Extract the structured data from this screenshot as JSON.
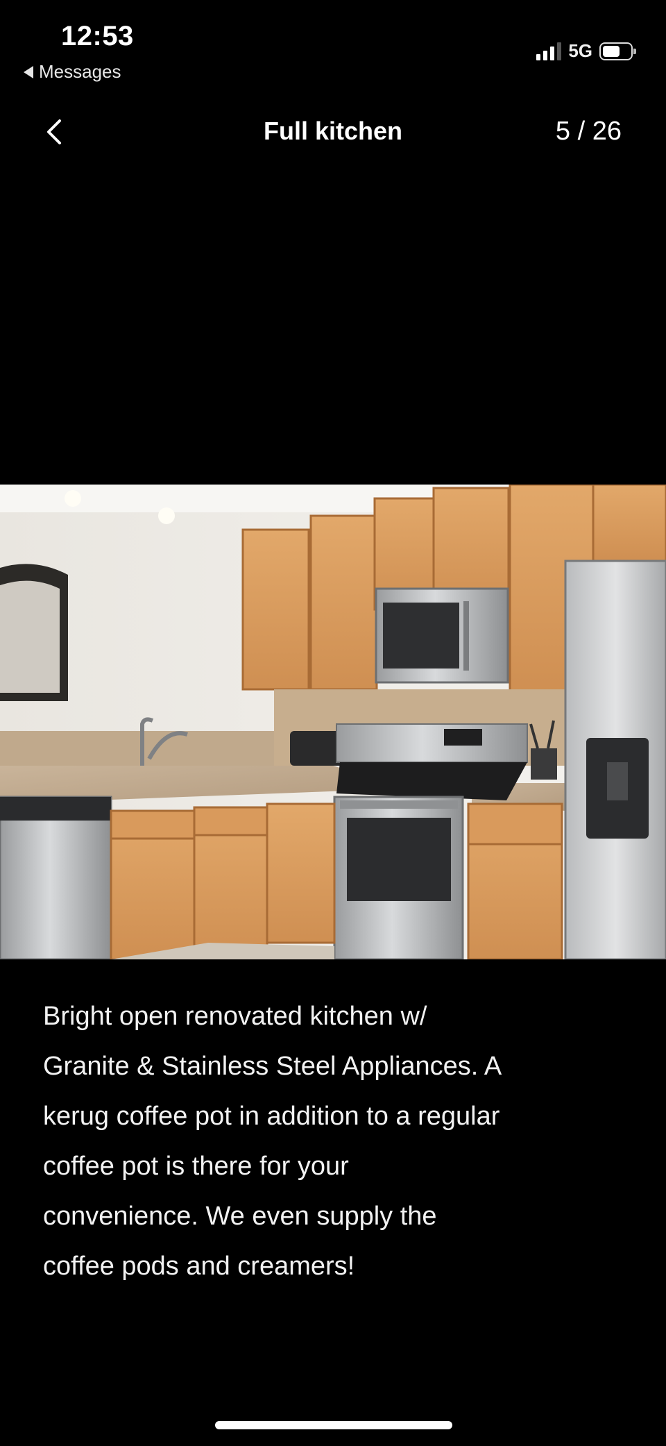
{
  "status_bar": {
    "time": "12:53",
    "back_app_label": "Messages",
    "network": "5G"
  },
  "header": {
    "title": "Full kitchen",
    "counter": "5 / 26",
    "back_icon": "chevron-left-icon"
  },
  "photo": {
    "subject": "kitchen-photo"
  },
  "caption": {
    "text": "Bright open renovated kitchen w/\nGranite & Stainless Steel Appliances.  A\nkerug coffee pot in addition to a regular\ncoffee pot is there for your\nconvenience. We even supply the\ncoffee pods and creamers!"
  },
  "colors": {
    "background": "#000000",
    "text": "#ffffff"
  }
}
